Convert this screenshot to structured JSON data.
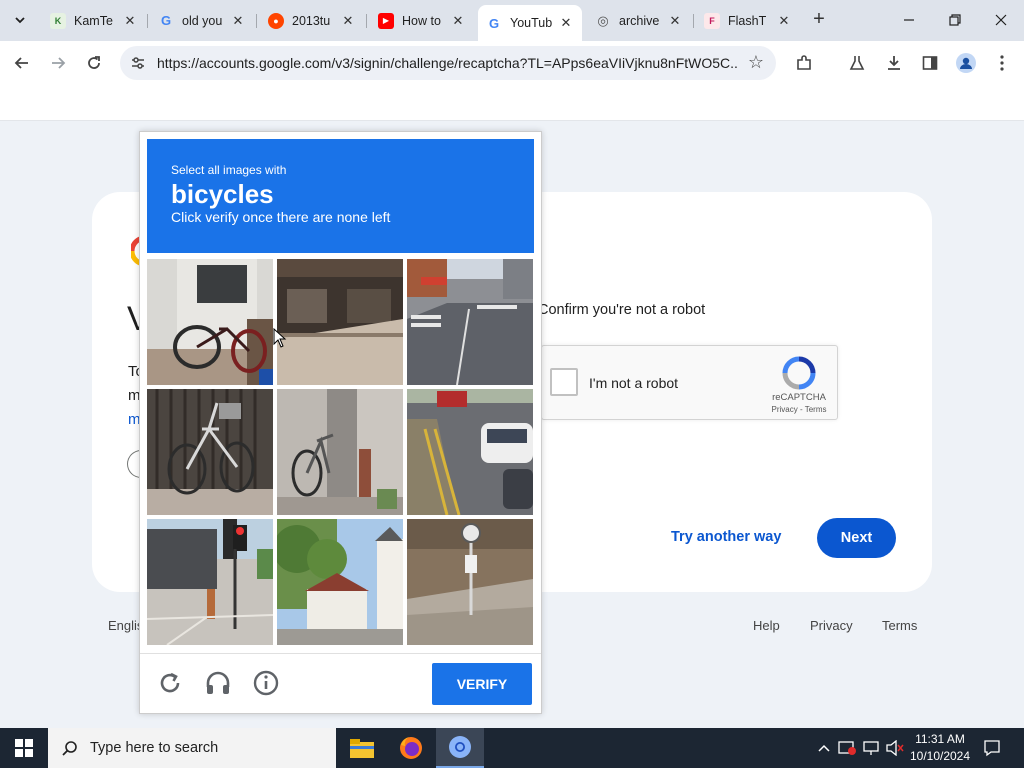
{
  "browser": {
    "tabs": [
      {
        "title": "KamTe",
        "favicon": "kamtera-icon"
      },
      {
        "title": "old you",
        "favicon": "google-icon"
      },
      {
        "title": "2013tu",
        "favicon": "reddit-icon"
      },
      {
        "title": "How to",
        "favicon": "youtube-icon"
      },
      {
        "title": "YouTub",
        "favicon": "google-icon",
        "active": true
      },
      {
        "title": "archive",
        "favicon": "globe-icon"
      },
      {
        "title": "FlashT",
        "favicon": "flash-icon"
      }
    ],
    "new_tab_label": "+",
    "url": "https://accounts.google.com/v3/signin/challenge/recaptcha?TL=APps6eaVIiVjknu8nFtWO5C..."
  },
  "login_page": {
    "confirm_text": "Confirm you're not a robot",
    "partial_heading": "V",
    "partial_lines": [
      "To",
      "m",
      "m"
    ],
    "recaptcha": {
      "checkbox_label": "I'm not a robot",
      "brand": "reCAPTCHA",
      "links": "Privacy - Terms"
    },
    "try_another_way": "Try another way",
    "next_label": "Next",
    "footer": {
      "language": "Englis",
      "help": "Help",
      "privacy": "Privacy",
      "terms": "Terms"
    }
  },
  "challenge": {
    "instruction_small": "Select all images with",
    "target": "bicycles",
    "instruction_sub": "Click verify once there are none left",
    "verify_label": "VERIFY",
    "header_color": "#1a73e8",
    "tiles": [
      {
        "subject": "bicycle-against-white-door"
      },
      {
        "subject": "storefront-sidewalk"
      },
      {
        "subject": "city-street-crosswalk"
      },
      {
        "subject": "white-bicycle-by-fence"
      },
      {
        "subject": "bicycle-by-pole"
      },
      {
        "subject": "street-with-cars"
      },
      {
        "subject": "traffic-light-corner"
      },
      {
        "subject": "houses-trees"
      },
      {
        "subject": "bus-stop-sign"
      }
    ]
  },
  "taskbar": {
    "search_placeholder": "Type here to search",
    "time": "11:31 AM",
    "date": "10/10/2024"
  }
}
